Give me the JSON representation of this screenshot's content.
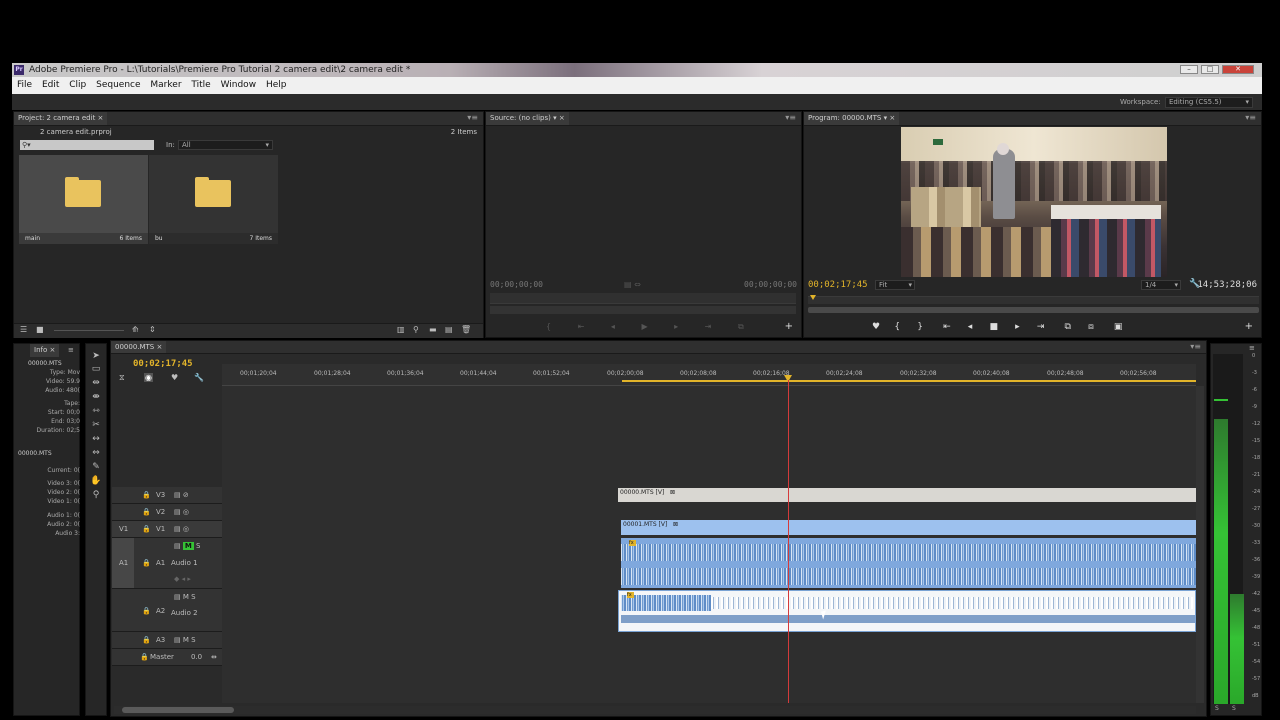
{
  "window": {
    "title": "Adobe Premiere Pro - L:\\Tutorials\\Premiere Pro Tutorial 2 camera edit\\2 camera edit *",
    "app_icon_label": "Pr"
  },
  "menu": [
    "File",
    "Edit",
    "Clip",
    "Sequence",
    "Marker",
    "Title",
    "Window",
    "Help"
  ],
  "workspace": {
    "label": "Workspace:",
    "value": "Editing (CS5.5)"
  },
  "project": {
    "tab": "Project: 2 camera edit",
    "file": "2 camera edit.prproj",
    "count": "2 Items",
    "in_label": "In:",
    "in_value": "All",
    "bins": [
      {
        "name": "main",
        "count": "6 Items"
      },
      {
        "name": "bu",
        "count": "7 Items"
      }
    ]
  },
  "source": {
    "tab": "Source: (no clips)",
    "tc_left": "00;00;00;00",
    "tc_right": "00;00;00;00"
  },
  "program": {
    "tab": "Program: 00000.MTS",
    "tc_current": "00;02;17;45",
    "fit": "Fit",
    "quality": "1/4",
    "tc_duration": "14;53;28;06"
  },
  "info": {
    "tab": "Info",
    "clip_name": "00000.MTS",
    "rows": [
      {
        "k": "Type:",
        "v": "Mov"
      },
      {
        "k": "Video:",
        "v": "59.9"
      },
      {
        "k": "Audio:",
        "v": "480("
      },
      {
        "k": "Tape:",
        "v": ""
      },
      {
        "k": "Start:",
        "v": "00;0"
      },
      {
        "k": "End:",
        "v": "03;0"
      },
      {
        "k": "Duration:",
        "v": "02;5"
      }
    ],
    "seq_name": "00000.MTS",
    "seq_rows": [
      {
        "k": "Current:",
        "v": "0("
      },
      {
        "k": "Video 3:",
        "v": "0("
      },
      {
        "k": "Video 2:",
        "v": "0("
      },
      {
        "k": "Video 1:",
        "v": "0("
      },
      {
        "k": "Audio 1:",
        "v": "0("
      },
      {
        "k": "Audio 2:",
        "v": "0("
      },
      {
        "k": "Audio 3:",
        "v": ""
      }
    ]
  },
  "timeline": {
    "tab": "00000.MTS",
    "tc": "00;02;17;45",
    "ruler": [
      "00;01;20;04",
      "00;01;28;04",
      "00;01;36;04",
      "00;01;44;04",
      "00;01;52;04",
      "00;02;00;08",
      "00;02;08;08",
      "00;02;16;08",
      "00;02;24;08",
      "00;02;32;08",
      "00;02;40;08",
      "00;02;48;08",
      "00;02;56;08"
    ],
    "tracks": {
      "v3": "V3",
      "v2": "V2",
      "v1": "V1",
      "v1_src": "V1",
      "a1": "A1",
      "a1_src": "A1",
      "a1_name": "Audio 1",
      "a2": "A2",
      "a2_name": "Audio 2",
      "a3": "A3",
      "master": "Master",
      "master_val": "0.0"
    },
    "clip_v3": "00000.MTS [V]",
    "clip_v1": "00001.MTS [V]"
  },
  "meter": {
    "labels": [
      "0",
      "-3",
      "-6",
      "-9",
      "-12",
      "-15",
      "-18",
      "-21",
      "-24",
      "-27",
      "-30",
      "-33",
      "-36",
      "-39",
      "-42",
      "-45",
      "-48",
      "-51",
      "-54",
      "-57",
      "dB"
    ],
    "buttons": [
      "S",
      "S"
    ]
  },
  "colors": {
    "accent": "#e2b42a",
    "playhead": "#d43b3b",
    "clip_v1": "#9dc1ee",
    "clip_v3": "#d9d7d2",
    "meter": "#35c235"
  }
}
